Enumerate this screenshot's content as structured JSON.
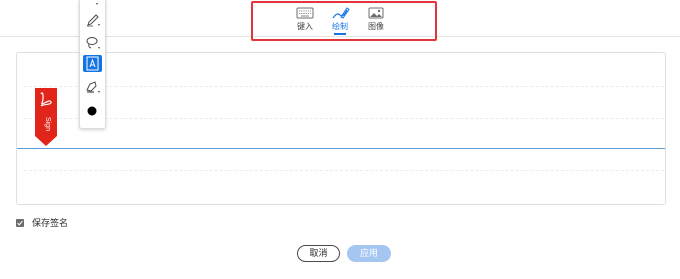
{
  "tabs": [
    {
      "label": "键入",
      "icon": "keyboard-icon"
    },
    {
      "label": "绘制",
      "icon": "pen-draw-icon"
    },
    {
      "label": "图像",
      "icon": "image-icon"
    }
  ],
  "active_tab": "绘制",
  "tools": [
    {
      "name": "pen-tool",
      "icon": "pen-icon"
    },
    {
      "name": "lasso-tool",
      "icon": "lasso-icon"
    },
    {
      "name": "text-tool",
      "icon": "text-box-icon",
      "selected": true
    },
    {
      "name": "highlighter-tool",
      "icon": "highlighter-icon"
    },
    {
      "name": "color-tool",
      "icon": "color-dot-icon"
    }
  ],
  "sign_marker": {
    "label": "Sign",
    "icon": "adobe-acrobat-icon",
    "color": "#e1251b"
  },
  "save": {
    "label": "保存签名",
    "checked": true
  },
  "buttons": {
    "cancel": "取消",
    "apply": "应用"
  },
  "colors": {
    "accent": "#1473e6",
    "highlight": "#e5343a",
    "apply_disabled": "#a4c6f1"
  }
}
